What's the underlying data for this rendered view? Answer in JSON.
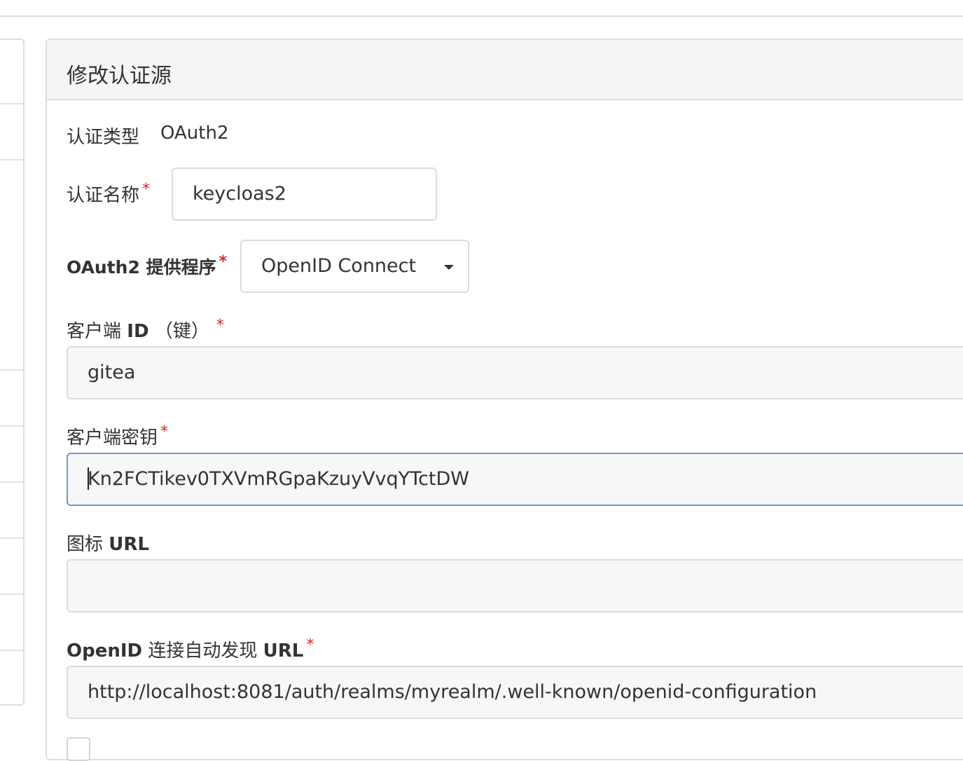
{
  "panel": {
    "title": "修改认证源"
  },
  "auth_type": {
    "label": "认证类型",
    "value": "OAuth2"
  },
  "auth_name": {
    "label": "认证名称",
    "required": "*",
    "value": "keycloas2"
  },
  "provider": {
    "label": "OAuth2 提供程序",
    "required": "*",
    "value": "OpenID Connect"
  },
  "client_id": {
    "label_prefix": "客户端",
    "label_bold": "ID",
    "label_suffix": "（键）",
    "required": "*",
    "value": "gitea"
  },
  "client_secret": {
    "label": "客户端密钥",
    "required": "*",
    "value": "Kn2FCTikev0TXVmRGpaKzuyVvqYTctDW"
  },
  "icon_url": {
    "label_prefix": "图标",
    "label_bold": "URL",
    "value": ""
  },
  "discovery_url": {
    "label_bold1": "OpenID",
    "label_mid": "连接自动发现",
    "label_bold2": "URL",
    "required": "*",
    "value": "http://localhost:8081/auth/realms/myrealm/.well-known/openid-configuration"
  },
  "colors": {
    "required": "#db2828",
    "focus_border": "#6b9bd2",
    "header_bg": "#f5f5f5"
  },
  "icons": {
    "provider_dropdown": "caret-down-icon"
  }
}
